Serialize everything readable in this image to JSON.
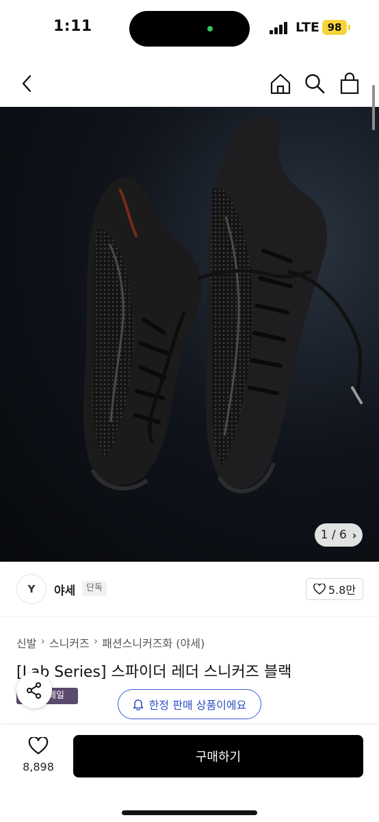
{
  "status_bar": {
    "time": "1:11",
    "network": "LTE",
    "battery": "98"
  },
  "nav": {
    "back_icon": "chevron-left-icon",
    "home_icon": "home-icon",
    "search_icon": "search-icon",
    "cart_icon": "shopping-bag-icon"
  },
  "image_gallery": {
    "current": "1",
    "separator": "/",
    "total": "6"
  },
  "brand": {
    "logo_text": "Y",
    "name": "야세",
    "tag": "단독",
    "likes": "5.8만"
  },
  "breadcrumb": [
    "신발",
    "스니커즈",
    "패션스니커즈화 (야세)"
  ],
  "product": {
    "title": "[Lab Series] 스파이더 레더 스니커즈 블랙",
    "sale_badge": "세일",
    "limited_notice": "한정 판매 상품이에요"
  },
  "bottom_bar": {
    "wish_count": "8,898",
    "buy_label": "구매하기"
  },
  "colors": {
    "accent_blue": "#3b5bdb",
    "buy_button": "#000000",
    "battery": "#f7d43a",
    "badge": "#5b4a6e"
  }
}
